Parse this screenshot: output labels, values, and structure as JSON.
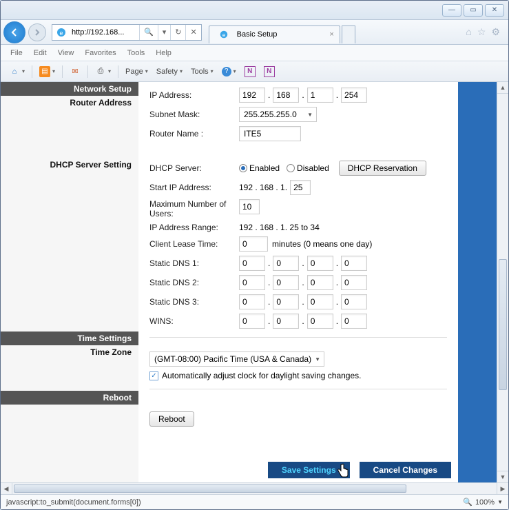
{
  "window": {
    "min": "—",
    "max": "▭",
    "close": "✕"
  },
  "nav": {
    "ie_e": "e",
    "url": "http://192.168...",
    "search_icon": "🔍",
    "refresh_glyph": "↻",
    "stop_glyph": "✕",
    "dropdown_glyph": "▾",
    "tab_title": "Basic Setup",
    "home_glyph": "⌂",
    "star_glyph": "☆",
    "gear_glyph": "⚙"
  },
  "menu": {
    "file": "File",
    "edit": "Edit",
    "view": "View",
    "favorites": "Favorites",
    "tools": "Tools",
    "help": "Help"
  },
  "toolbar": {
    "page": "Page",
    "safety": "Safety",
    "tools": "Tools",
    "home_glyph": "⌂",
    "rss_glyph": "▤",
    "mail_glyph": "✉",
    "print_glyph": "⎙",
    "help_glyph": "?",
    "n1": "N",
    "n2": "N"
  },
  "sections": {
    "network_setup": "Network Setup",
    "router_address": "Router Address",
    "dhcp_server_setting": "DHCP Server Setting",
    "time_settings": "Time Settings",
    "time_zone": "Time Zone",
    "reboot": "Reboot"
  },
  "labels": {
    "ip_address": "IP Address:",
    "subnet_mask": "Subnet Mask:",
    "router_name": "Router Name :",
    "dhcp_server": "DHCP Server:",
    "start_ip": "Start IP Address:",
    "max_users": "Maximum Number of Users:",
    "ip_range": "IP Address Range:",
    "lease_time": "Client Lease Time:",
    "dns1": "Static DNS 1:",
    "dns2": "Static DNS 2:",
    "dns3": "Static DNS 3:",
    "wins": "WINS:",
    "enabled": "Enabled",
    "disabled": "Disabled",
    "dhcp_reservation": "DHCP Reservation",
    "start_prefix": "192 . 168 . 1.",
    "ip_range_val": "192 . 168 . 1. 25 to 34",
    "lease_suffix": "minutes (0 means one day)",
    "auto_dst": "Automatically adjust clock for daylight saving changes.",
    "reboot_btn": "Reboot",
    "save": "Save Settings",
    "cancel": "Cancel Changes"
  },
  "values": {
    "ip": [
      "192",
      "168",
      "1",
      "254"
    ],
    "subnet": "255.255.255.0",
    "router_name": "ITE5",
    "start_ip_last": "25",
    "max_users": "10",
    "lease": "0",
    "dns1": [
      "0",
      "0",
      "0",
      "0"
    ],
    "dns2": [
      "0",
      "0",
      "0",
      "0"
    ],
    "dns3": [
      "0",
      "0",
      "0",
      "0"
    ],
    "wins": [
      "0",
      "0",
      "0",
      "0"
    ],
    "timezone": "(GMT-08:00) Pacific Time (USA & Canada)",
    "dst_checked": "✓"
  },
  "status": {
    "text": "javascript:to_submit(document.forms[0])",
    "zoom_icon": "🔍",
    "zoom": "100%"
  }
}
